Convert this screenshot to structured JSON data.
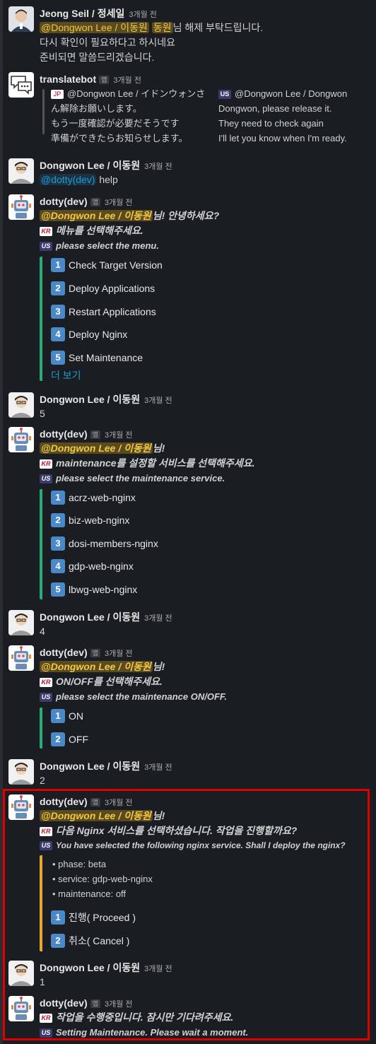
{
  "messages": {
    "m1": {
      "name": "Jeong Seil / 정세일",
      "time": "3개월 전",
      "mention": "@Dongwon Lee / 이동원",
      "mention2": "동원",
      "line1_rest": "님 해제 부탁드립니다.",
      "line2": "다시 확인이 필요하다고 하시네요",
      "line3": "준비되면 말씀드리겠습니다."
    },
    "m2": {
      "name": "translatebot",
      "badge": "앱",
      "time": "3개월 전",
      "jp_flag": "JP",
      "jp": [
        "@Dongwon Lee / イドンウォンさ",
        "ん解除お願いします。",
        "もう一度確認が必要だそうです",
        "準備ができたらお知らせします。"
      ],
      "us_flag": "US",
      "en": [
        "@Dongwon Lee / Dongwon",
        "Dongwon, please release it.",
        "They need to check again",
        "I'll let you know when I'm ready."
      ]
    },
    "m3": {
      "name": "Dongwon Lee / 이동원",
      "time": "3개월 전",
      "mention": "@dotty(dev)",
      "text": " help"
    },
    "m4": {
      "name": "dotty(dev)",
      "badge": "앱",
      "time": "3개월 전",
      "mention": "@Dongwon Lee / 이동원",
      "greeting": "님! 안녕하세요?",
      "kr_flag": "KR",
      "kr": "메뉴를 선택해주세요.",
      "us_flag": "US",
      "en": "please select the menu.",
      "items": [
        {
          "num": "1",
          "label": "Check Target Version"
        },
        {
          "num": "2",
          "label": "Deploy Applications"
        },
        {
          "num": "3",
          "label": "Restart Applications"
        },
        {
          "num": "4",
          "label": "Deploy Nginx"
        },
        {
          "num": "5",
          "label": "Set Maintenance"
        }
      ],
      "more": "더 보기"
    },
    "m5": {
      "name": "Dongwon Lee / 이동원",
      "time": "3개월 전",
      "text": "5"
    },
    "m6": {
      "name": "dotty(dev)",
      "badge": "앱",
      "time": "3개월 전",
      "mention": "@Dongwon Lee / 이동원",
      "greeting": "님!",
      "kr_flag": "KR",
      "kr": "maintenance를 설정할 서비스를 선택해주세요.",
      "us_flag": "US",
      "en": "please select the maintenance service.",
      "items": [
        {
          "num": "1",
          "label": "acrz-web-nginx"
        },
        {
          "num": "2",
          "label": "biz-web-nginx"
        },
        {
          "num": "3",
          "label": "dosi-members-nginx"
        },
        {
          "num": "4",
          "label": "gdp-web-nginx"
        },
        {
          "num": "5",
          "label": "lbwg-web-nginx"
        }
      ]
    },
    "m7": {
      "name": "Dongwon Lee / 이동원",
      "time": "3개월 전",
      "text": "4"
    },
    "m8": {
      "name": "dotty(dev)",
      "badge": "앱",
      "time": "3개월 전",
      "mention": "@Dongwon Lee / 이동원",
      "greeting": "님!",
      "kr_flag": "KR",
      "kr": "ON/OFF를 선택해주세요.",
      "us_flag": "US",
      "en": "please select the maintenance ON/OFF.",
      "items": [
        {
          "num": "1",
          "label": "ON"
        },
        {
          "num": "2",
          "label": "OFF"
        }
      ]
    },
    "m9": {
      "name": "Dongwon Lee / 이동원",
      "time": "3개월 전",
      "text": "2"
    },
    "m10": {
      "name": "dotty(dev)",
      "badge": "앱",
      "time": "3개월 전",
      "mention": "@Dongwon Lee / 이동원",
      "greeting": "님!",
      "kr_flag": "KR",
      "kr": "다음 Nginx 서비스를 선택하셨습니다. 작업을 진행할까요?",
      "us_flag": "US",
      "en": "You have selected the following nginx service. Shall I deploy the nginx?",
      "bullets": [
        "• phase: beta",
        "• service: gdp-web-nginx",
        "• maintenance: off"
      ],
      "items": [
        {
          "num": "1",
          "label": "진행( Proceed )"
        },
        {
          "num": "2",
          "label": "취소( Cancel )"
        }
      ]
    },
    "m11": {
      "name": "Dongwon Lee / 이동원",
      "time": "3개월 전",
      "text": "1"
    },
    "m12": {
      "name": "dotty(dev)",
      "badge": "앱",
      "time": "3개월 전",
      "kr_flag": "KR",
      "kr": "작업을 수행중입니다. 잠시만 기다려주세요.",
      "us_flag": "US",
      "en": "Setting Maintenance. Please wait a moment."
    }
  }
}
